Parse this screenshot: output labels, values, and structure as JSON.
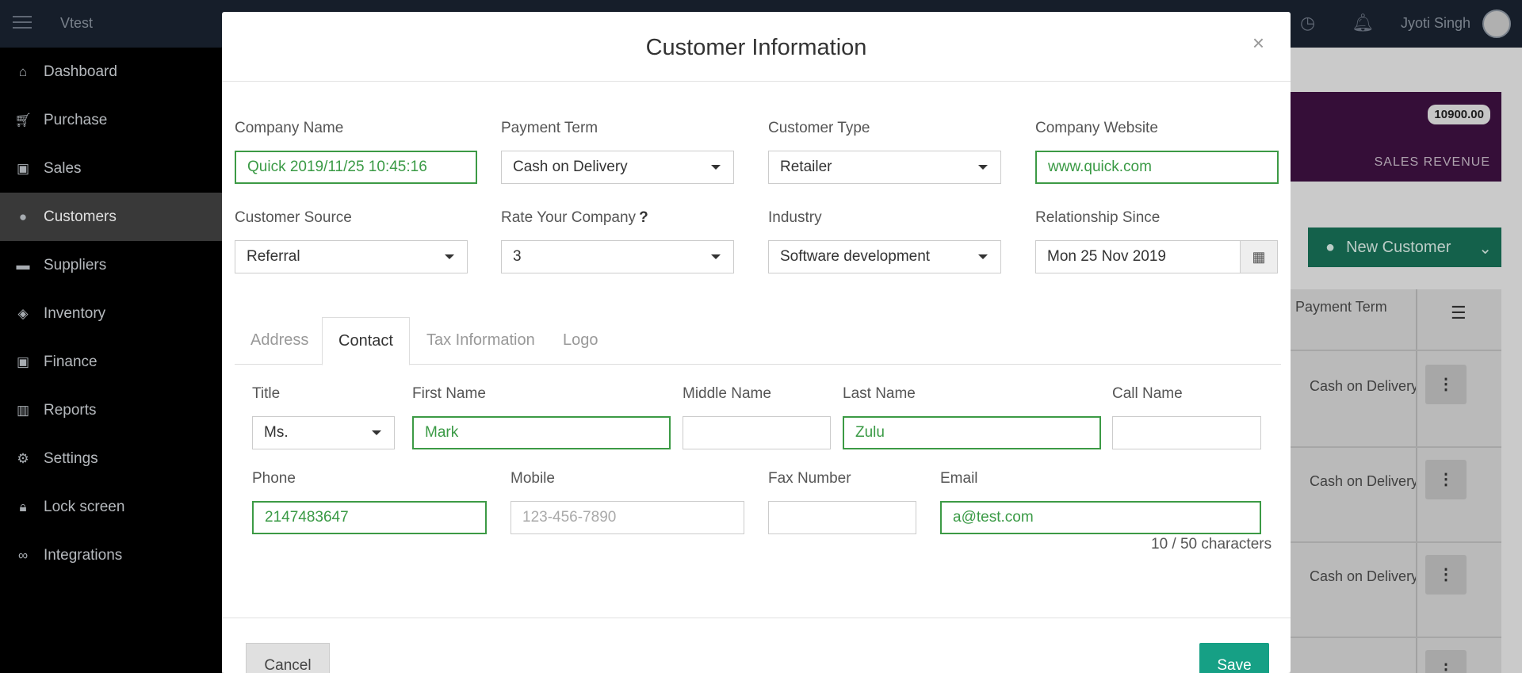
{
  "app": {
    "name": "Vtest",
    "user": "Jyoti Singh"
  },
  "sidebar": {
    "items": [
      {
        "label": "Dashboard",
        "icon": "home-icon"
      },
      {
        "label": "Purchase",
        "icon": "cart-icon"
      },
      {
        "label": "Sales",
        "icon": "money-icon"
      },
      {
        "label": "Customers",
        "icon": "user-icon",
        "active": true
      },
      {
        "label": "Suppliers",
        "icon": "truck-icon"
      },
      {
        "label": "Inventory",
        "icon": "cubes-icon"
      },
      {
        "label": "Finance",
        "icon": "money-icon"
      },
      {
        "label": "Reports",
        "icon": "bar-chart-icon"
      },
      {
        "label": "Settings",
        "icon": "gears-icon"
      },
      {
        "label": "Lock screen",
        "icon": "lock-icon"
      },
      {
        "label": "Integrations",
        "icon": "link-icon"
      }
    ]
  },
  "background": {
    "revenue_value": "10900.00",
    "revenue_label": "SALES REVENUE",
    "new_customer_label": "New Customer",
    "table_header": "Payment Term",
    "rows": [
      "Cash on Delivery",
      "Cash on Delivery",
      "Cash on Delivery"
    ]
  },
  "modal": {
    "title": "Customer Information",
    "close": "×",
    "company_name": {
      "label": "Company Name",
      "value": "Quick 2019/11/25 10:45:16"
    },
    "payment_term": {
      "label": "Payment Term",
      "value": "Cash on Delivery"
    },
    "customer_type": {
      "label": "Customer Type",
      "value": "Retailer"
    },
    "company_website": {
      "label": "Company Website",
      "value": "www.quick.com"
    },
    "customer_source": {
      "label": "Customer Source",
      "value": "Referral"
    },
    "rate_company": {
      "label": "Rate Your Company",
      "help": "?",
      "value": "3"
    },
    "industry": {
      "label": "Industry",
      "value": "Software development"
    },
    "relationship_since": {
      "label": "Relationship Since",
      "value": "Mon 25 Nov 2019"
    },
    "tabs": [
      "Address",
      "Contact",
      "Tax Information",
      "Logo"
    ],
    "contact": {
      "title": {
        "label": "Title",
        "value": "Ms."
      },
      "first_name": {
        "label": "First Name",
        "value": "Mark"
      },
      "middle_name": {
        "label": "Middle Name",
        "value": ""
      },
      "last_name": {
        "label": "Last Name",
        "value": "Zulu"
      },
      "call_name": {
        "label": "Call Name",
        "value": ""
      },
      "phone": {
        "label": "Phone",
        "value": "2147483647"
      },
      "mobile": {
        "label": "Mobile",
        "placeholder": "123-456-7890"
      },
      "fax": {
        "label": "Fax Number",
        "value": ""
      },
      "email": {
        "label": "Email",
        "value": "a@test.com"
      },
      "email_counter": "10 / 50 characters"
    },
    "cancel_label": "Cancel",
    "save_label": "Save"
  }
}
